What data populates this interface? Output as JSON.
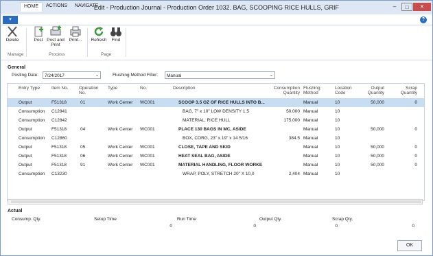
{
  "window": {
    "title": "Edit - Production Journal - Production Order 1032. BAG, SCOOPING RICE HULLS, GRIF"
  },
  "tabs": [
    {
      "label": "HOME"
    },
    {
      "label": "ACTIONS"
    },
    {
      "label": "NAVIGATE"
    }
  ],
  "ribbon": {
    "buttons": [
      {
        "label": "Delete",
        "icon": "delete-x-icon"
      },
      {
        "label": "Post",
        "icon": "post-icon"
      },
      {
        "label": "Post and Print",
        "icon": "post-print-icon"
      },
      {
        "label": "Print...",
        "icon": "print-icon"
      },
      {
        "label": "Refresh",
        "icon": "refresh-icon"
      },
      {
        "label": "Find",
        "icon": "binoculars-icon"
      }
    ],
    "groups": [
      "Manage",
      "Process",
      "Page"
    ]
  },
  "general": {
    "heading": "General",
    "posting_date_label": "Posting Date:",
    "posting_date": "7/24/2017",
    "flushing_label": "Flushing Method Filter:",
    "flushing_value": "Manual"
  },
  "grid": {
    "headers": [
      "Entry Type",
      "Item No.",
      "Operation No.",
      "Type",
      "No.",
      "Description",
      "Consumption Quantity",
      "Flushing Method",
      "Location Code",
      "Output Quantity",
      "Scrap Quantity"
    ],
    "rows": [
      {
        "entry_type": "Output",
        "item_no": "F51318",
        "op_no": "01",
        "type": "Work Center",
        "no": "WC001",
        "description": "SCOOP 3.5 OZ OF RICE HULLS INTO B...",
        "consumption": "",
        "flushing": "Manual",
        "location": "10",
        "output": "50,000",
        "scrap": "0",
        "bold": true
      },
      {
        "entry_type": "Consumption",
        "item_no": "C12841",
        "op_no": "",
        "type": "",
        "no": "",
        "description": "BAG, 7\" x 10\" LOW DENSITY 1.5",
        "consumption": "50,000",
        "flushing": "Manual",
        "location": "10",
        "output": "",
        "scrap": "",
        "bold": false
      },
      {
        "entry_type": "Consumption",
        "item_no": "C12842",
        "op_no": "",
        "type": "",
        "no": "",
        "description": "MATERIAL, RICE HULL",
        "consumption": "175,000",
        "flushing": "Manual",
        "location": "10",
        "output": "",
        "scrap": "",
        "bold": false
      },
      {
        "entry_type": "Output",
        "item_no": "F51318",
        "op_no": "04",
        "type": "Work Center",
        "no": "WC001",
        "description": "PLACE 130 BAGS IN MC, ASIDE",
        "consumption": "",
        "flushing": "Manual",
        "location": "10",
        "output": "50,000",
        "scrap": "0",
        "bold": true
      },
      {
        "entry_type": "Consumption",
        "item_no": "C12860",
        "op_no": "",
        "type": "",
        "no": "",
        "description": "BOX, CORG, 23\" x 19\" x 14 5/16",
        "consumption": "384.5",
        "flushing": "Manual",
        "location": "10",
        "output": "",
        "scrap": "",
        "bold": false
      },
      {
        "entry_type": "Output",
        "item_no": "F51318",
        "op_no": "05",
        "type": "Work Center",
        "no": "WC001",
        "description": "CLOSE, TAPE AND SKID",
        "consumption": "",
        "flushing": "Manual",
        "location": "10",
        "output": "50,000",
        "scrap": "0",
        "bold": true
      },
      {
        "entry_type": "Output",
        "item_no": "F51318",
        "op_no": "06",
        "type": "Work Center",
        "no": "WC001",
        "description": "HEAT SEAL BAG, ASIDE",
        "consumption": "",
        "flushing": "Manual",
        "location": "10",
        "output": "50,000",
        "scrap": "0",
        "bold": true
      },
      {
        "entry_type": "Output",
        "item_no": "F51318",
        "op_no": "91",
        "type": "Work Center",
        "no": "WC001",
        "description": "MATERIAL HANDLING, FLOOR WORKE",
        "consumption": "",
        "flushing": "Manual",
        "location": "10",
        "output": "50,000",
        "scrap": "0",
        "bold": true
      },
      {
        "entry_type": "Consumption",
        "item_no": "C13230",
        "op_no": "",
        "type": "",
        "no": "",
        "description": "WRAP, POLY, STRETCH 20\" X 10,0",
        "consumption": "2,404",
        "flushing": "Manual",
        "location": "10",
        "output": "",
        "scrap": "",
        "bold": false
      }
    ]
  },
  "actual": {
    "heading": "Actual",
    "fields": [
      {
        "label": "Consump. Qty.",
        "value": ""
      },
      {
        "label": "Setup Time",
        "value": "0"
      },
      {
        "label": "Run Time",
        "value": "0"
      },
      {
        "label": "Output Qty.",
        "value": "0"
      },
      {
        "label": "Scrap Qty.",
        "value": "0"
      }
    ]
  },
  "ok_label": "OK",
  "colors": {
    "accent": "#2a6cc0",
    "selected_row": "#c7ddf2"
  }
}
